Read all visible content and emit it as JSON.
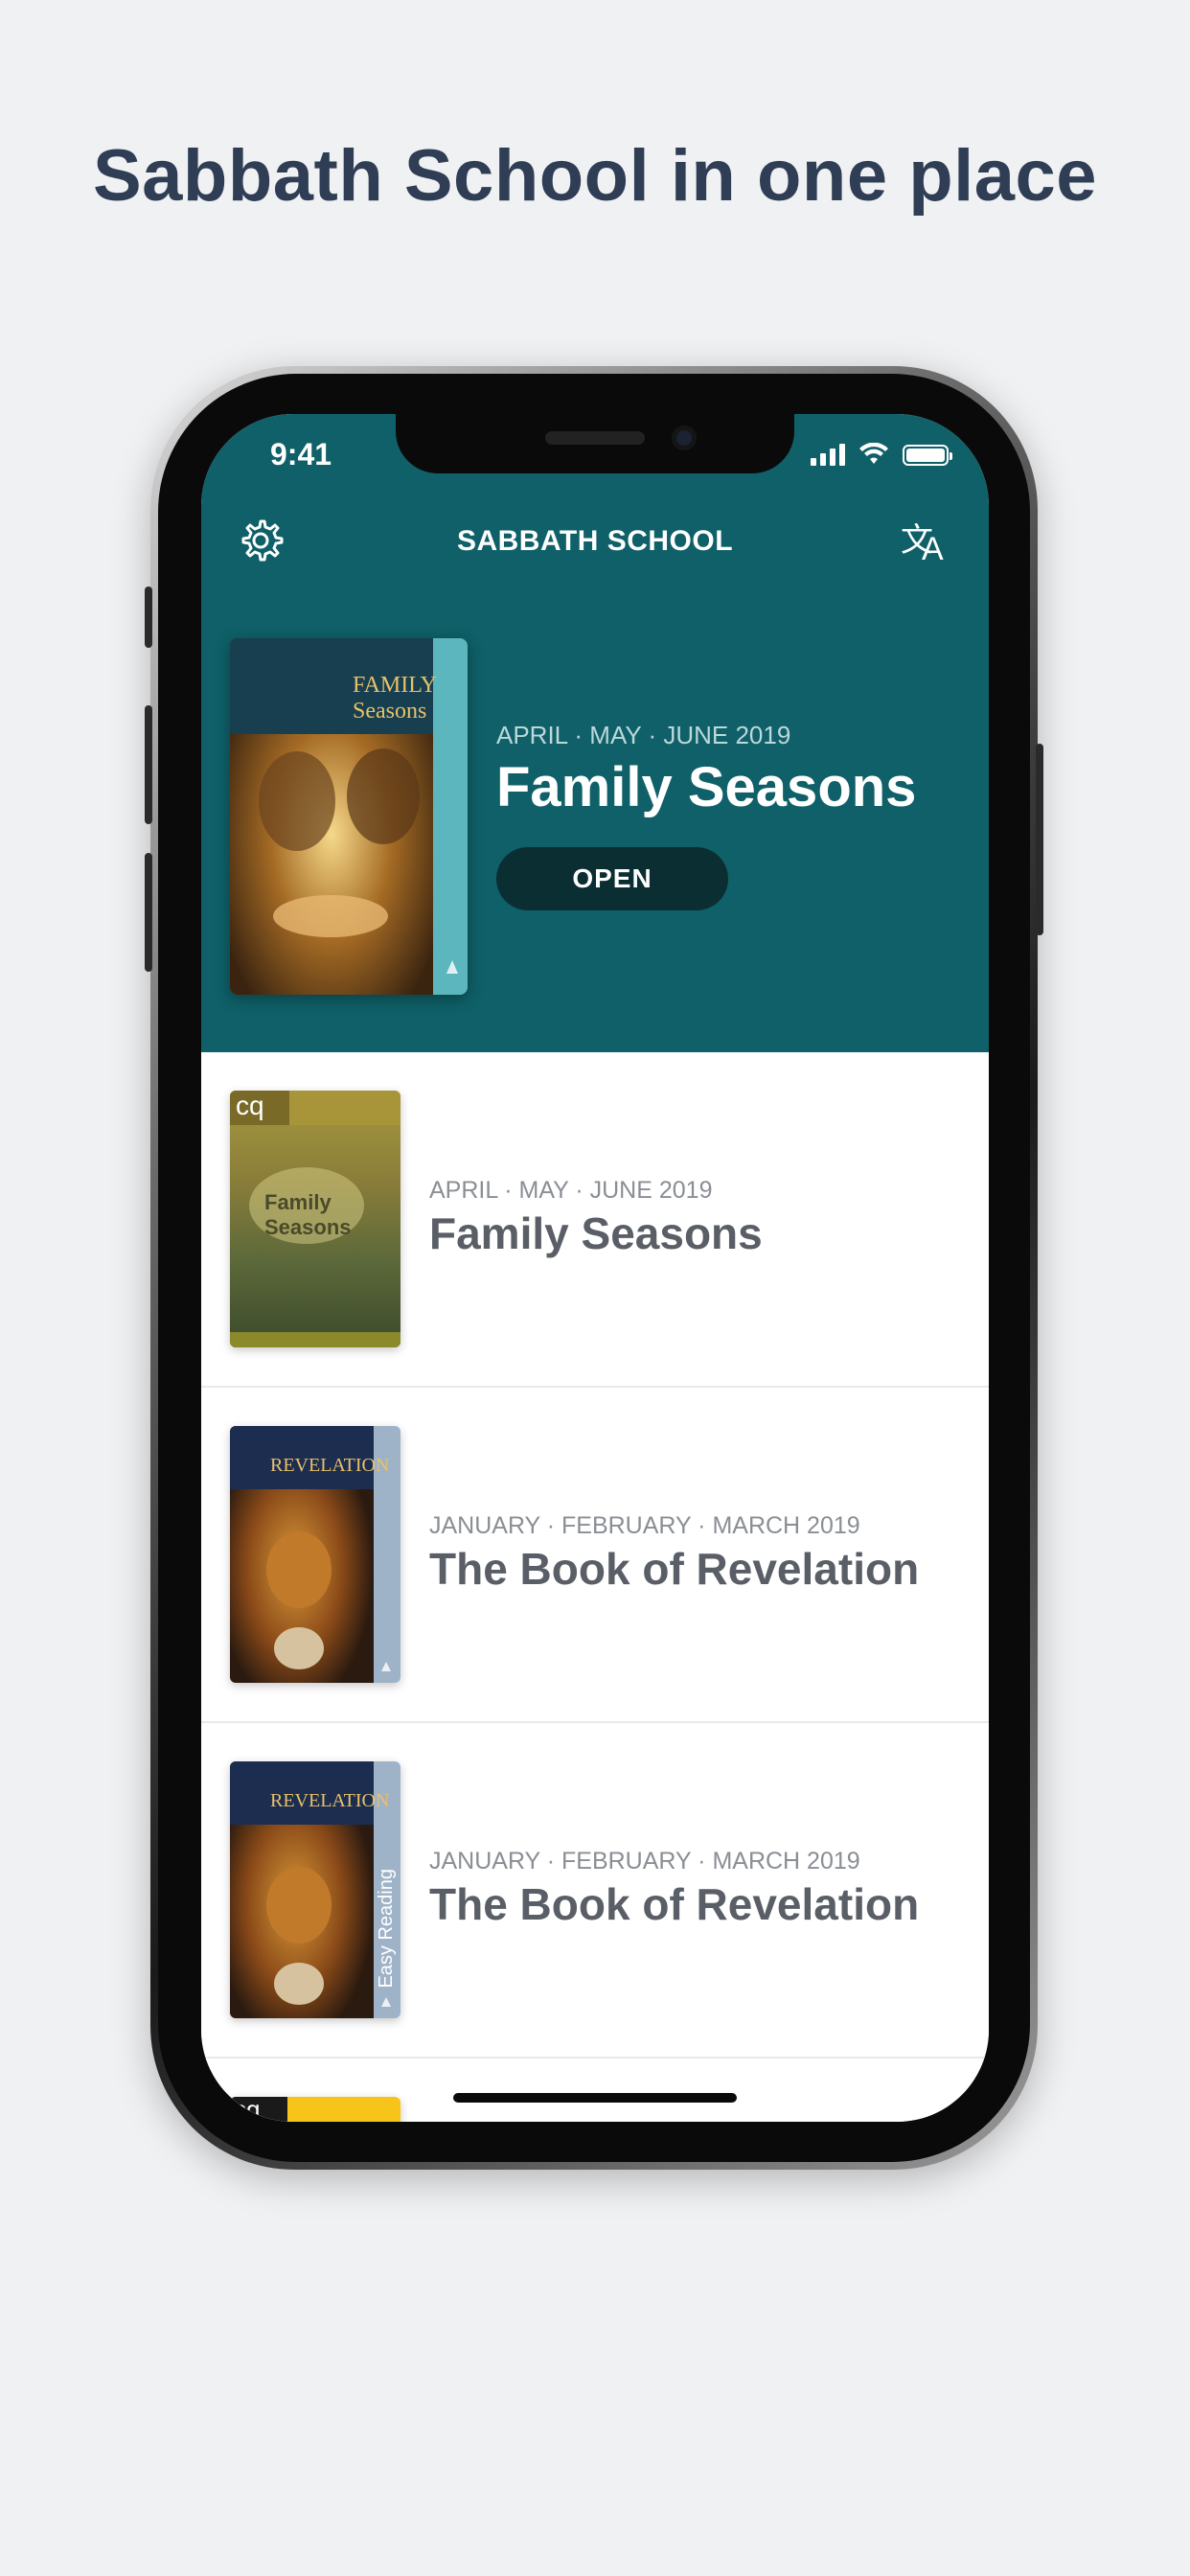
{
  "headline": "Sabbath School in one place",
  "status": {
    "time": "9:41"
  },
  "navbar": {
    "title": "SABBATH SCHOOL",
    "settings_icon": "gear-icon",
    "language_icon": "translate-icon"
  },
  "featured": {
    "date": "APRIL · MAY · JUNE 2019",
    "title": "Family Seasons",
    "button_label": "OPEN",
    "cover_title": "FAMILY Seasons"
  },
  "quarterlies": [
    {
      "date": "APRIL · MAY · JUNE 2019",
      "title": "Family Seasons",
      "cover_text": "Family Seasons",
      "cover_badge": "cq"
    },
    {
      "date": "JANUARY · FEBRUARY · MARCH 2019",
      "title": "The Book of Revelation",
      "cover_text": "REVELATION"
    },
    {
      "date": "JANUARY · FEBRUARY · MARCH 2019",
      "title": "The Book of Revelation",
      "cover_text": "REVELATION",
      "cover_badge": "Easy Reading"
    },
    {
      "date": "",
      "title": "",
      "cover_badge": "cq"
    }
  ],
  "colors": {
    "hero": "#0f6068",
    "button": "#0b2e33",
    "accent": "#5bb6bd"
  }
}
